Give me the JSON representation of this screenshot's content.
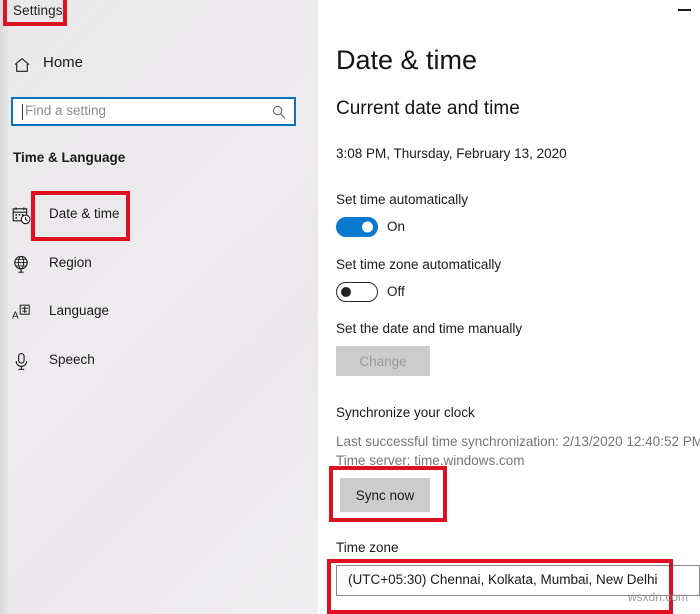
{
  "window": {
    "title": "Settings",
    "minimize_label": "—"
  },
  "sidebar": {
    "home_label": "Home",
    "home_icon": "home-icon",
    "search": {
      "placeholder": "Find a setting",
      "value": "",
      "icon": "search-icon"
    },
    "section_header": "Time & Language",
    "items": [
      {
        "label": "Date & time",
        "icon": "calendar-clock-icon",
        "selected": true
      },
      {
        "label": "Region",
        "icon": "globe-icon",
        "selected": false
      },
      {
        "label": "Language",
        "icon": "language-character-icon",
        "selected": false
      },
      {
        "label": "Speech",
        "icon": "microphone-icon",
        "selected": false
      }
    ]
  },
  "main": {
    "page_title": "Date & time",
    "sub_title": "Current date and time",
    "current_datetime": "3:08 PM, Thursday, February 13, 2020",
    "set_time_auto": {
      "label": "Set time automatically",
      "state": "On",
      "on": true
    },
    "set_timezone_auto": {
      "label": "Set time zone automatically",
      "state": "Off",
      "on": false
    },
    "manual": {
      "label": "Set the date and time manually",
      "button_label": "Change",
      "disabled": true
    },
    "sync": {
      "header": "Synchronize your clock",
      "last_sync": "Last successful time synchronization: 2/13/2020 12:40:52 PM",
      "time_server": "Time server: time.windows.com",
      "button_label": "Sync now"
    },
    "timezone": {
      "label": "Time zone",
      "value": "(UTC+05:30) Chennai, Kolkata, Mumbai, New Delhi"
    }
  },
  "annotations": {
    "color": "#dd1122",
    "boxes": [
      "settings-title",
      "date-and-time-nav-item",
      "sync-now-button",
      "time-zone-select"
    ]
  },
  "watermark": "wsxdn.com"
}
